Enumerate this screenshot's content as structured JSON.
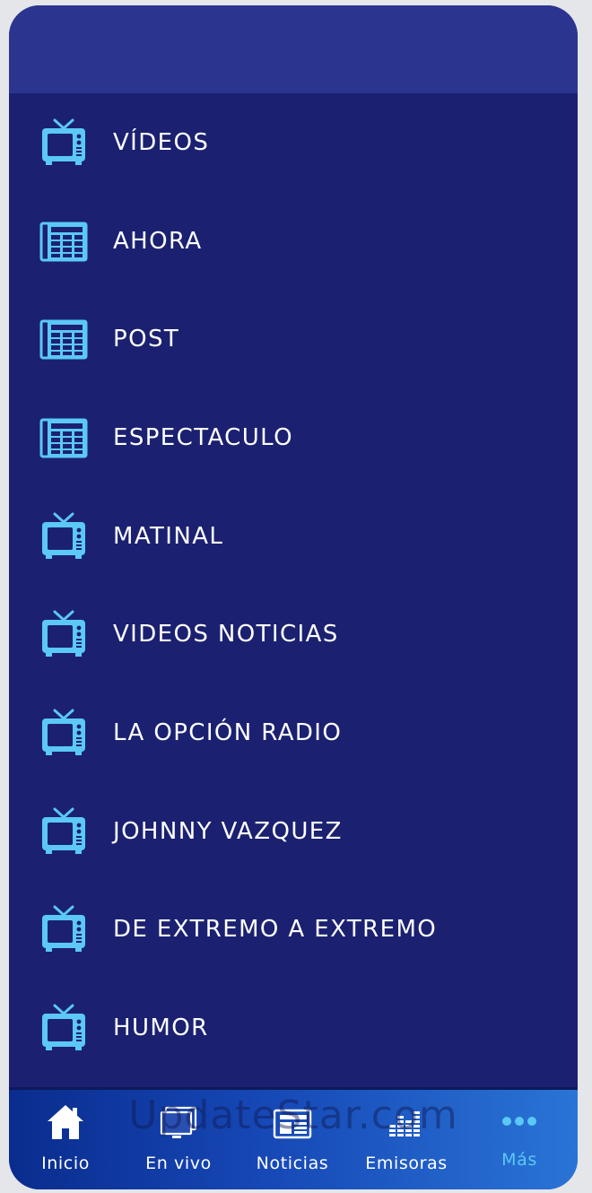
{
  "colors": {
    "background": "#1b2170",
    "header": "#2b3590",
    "icon": "#5bc8f5",
    "text": "#ffffff",
    "active_tab": "#5bc8f5"
  },
  "menu": {
    "items": [
      {
        "label": "VÍDEOS",
        "icon": "tv-icon"
      },
      {
        "label": "AHORA",
        "icon": "newspaper-icon"
      },
      {
        "label": "POST",
        "icon": "newspaper-icon"
      },
      {
        "label": "ESPECTACULO",
        "icon": "newspaper-icon"
      },
      {
        "label": "MATINAL",
        "icon": "tv-icon"
      },
      {
        "label": "VIDEOS NOTICIAS",
        "icon": "tv-icon"
      },
      {
        "label": "LA OPCIÓN RADIO",
        "icon": "tv-icon"
      },
      {
        "label": "JOHNNY VAZQUEZ",
        "icon": "tv-icon"
      },
      {
        "label": "DE EXTREMO A EXTREMO",
        "icon": "tv-icon"
      },
      {
        "label": "HUMOR",
        "icon": "tv-icon"
      }
    ]
  },
  "tabbar": {
    "tabs": [
      {
        "label": "Inicio",
        "icon": "home-icon",
        "active": false
      },
      {
        "label": "En vivo",
        "icon": "monitor-icon",
        "active": false
      },
      {
        "label": "Noticias",
        "icon": "newspaper-icon",
        "active": false
      },
      {
        "label": "Emisoras",
        "icon": "equalizer-icon",
        "active": false
      },
      {
        "label": "Más",
        "icon": "more-icon",
        "active": true
      }
    ]
  },
  "watermark": "UpdateStar.com"
}
